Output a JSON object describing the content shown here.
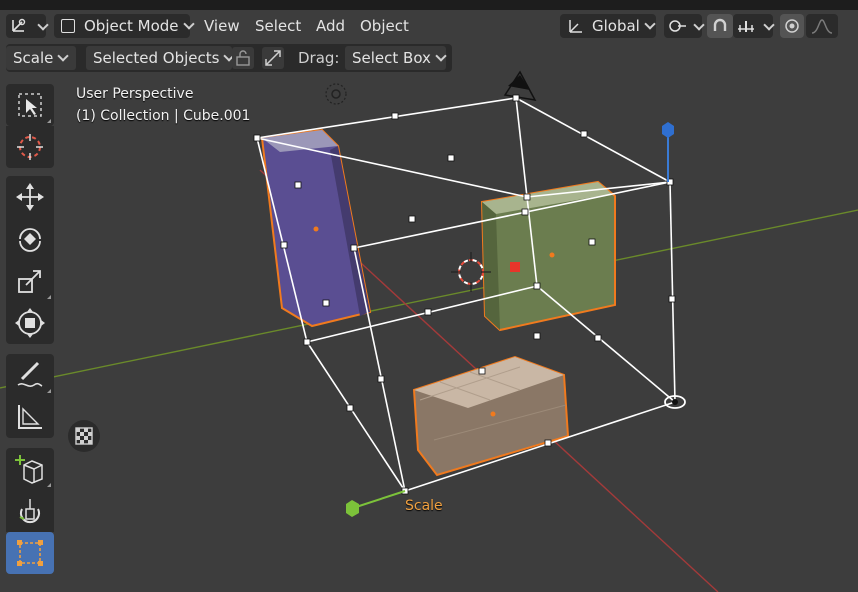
{
  "header": {
    "mode_label": "Object Mode",
    "menus": [
      "View",
      "Select",
      "Add",
      "Object"
    ],
    "orientation_label": "Global"
  },
  "tool_settings": {
    "transform_label": "Scale",
    "affect_label": "Selected Objects",
    "drag_label": "Drag:",
    "drag_value": "Select Box"
  },
  "viewport": {
    "view_name": "User Perspective",
    "collection_info": "(1) Collection | Cube.001",
    "gizmo_label": "Scale"
  },
  "toolbar": {
    "tools": [
      "select-box",
      "cursor",
      "move",
      "rotate",
      "scale",
      "transform",
      "annotate",
      "measure",
      "add-cube",
      "spin",
      "scale-cage"
    ],
    "active_tool": "scale-cage"
  },
  "colors": {
    "viewport_bg": "#3d3d3d",
    "selection_orange": "#f07a1e",
    "active_tool": "#4772b3",
    "x_axis": "#c0392b",
    "y_axis": "#6a9a2a",
    "z_axis": "#3a7bd5"
  }
}
